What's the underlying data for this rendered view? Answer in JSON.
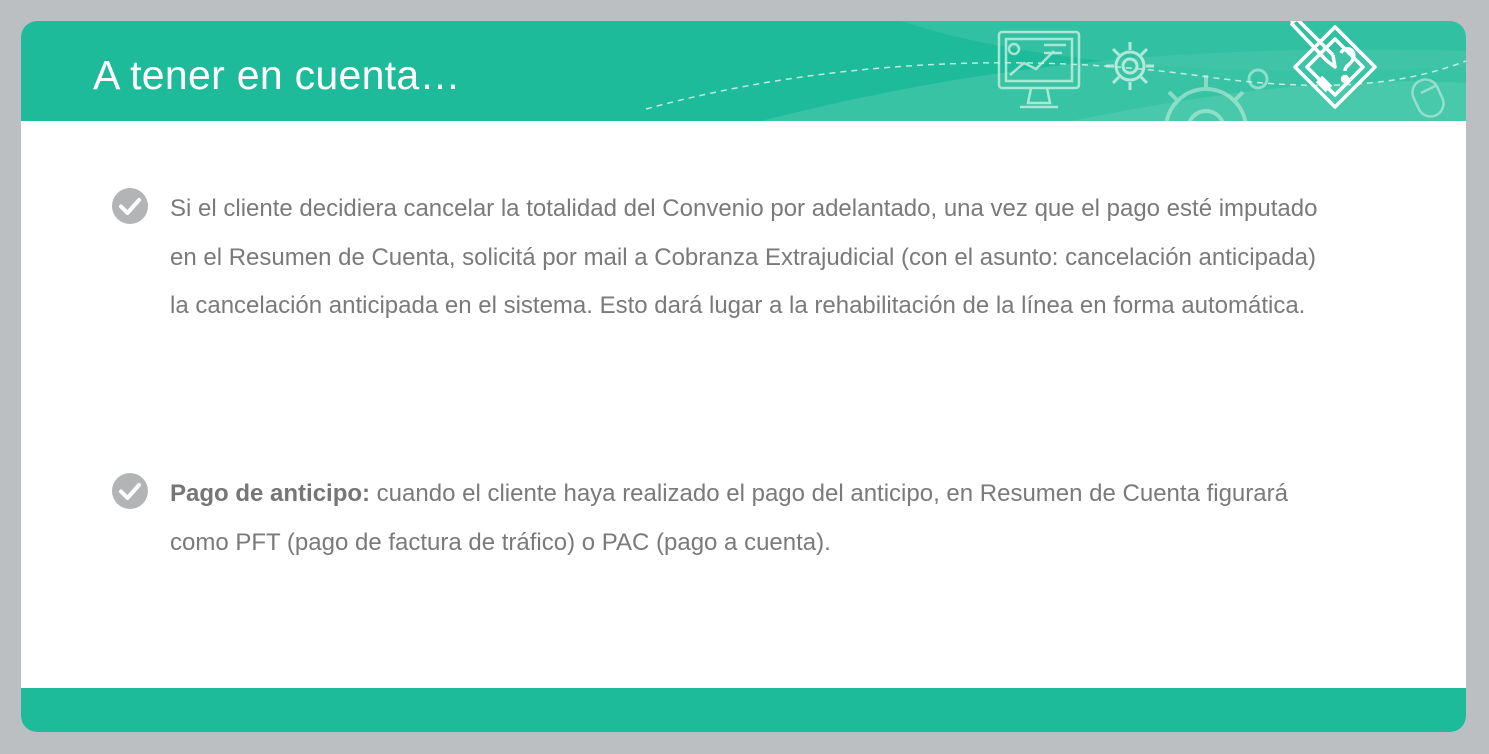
{
  "header": {
    "title": "A tener en cuenta…",
    "decorative_icons": [
      "monitor-chart-icon",
      "gear-icon",
      "large-gear-icon",
      "mouse-icon",
      "document-pencil-icon"
    ]
  },
  "bullets": [
    {
      "icon": "check-circle-icon",
      "bold_prefix": "",
      "text": "Si el cliente decidiera cancelar la totalidad del Convenio por adelantado, una vez que el pago esté imputado en el Resumen de Cuenta, solicitá por mail a Cobranza Extrajudicial (con el asunto: cancelación anticipada) la cancelación anticipada en el sistema. Esto dará lugar a la rehabilitación de la línea en forma automática."
    },
    {
      "icon": "check-circle-icon",
      "bold_prefix": "Pago de anticipo:",
      "text": " cuando el cliente haya realizado el pago del anticipo, en Resumen de Cuenta figurará como PFT (pago de factura de tráfico) o PAC (pago a cuenta)."
    }
  ],
  "colors": {
    "accent": "#1dbb99",
    "background": "#bcbfc2",
    "text": "#7a7a7a",
    "check_circle": "#b3b4b6"
  }
}
